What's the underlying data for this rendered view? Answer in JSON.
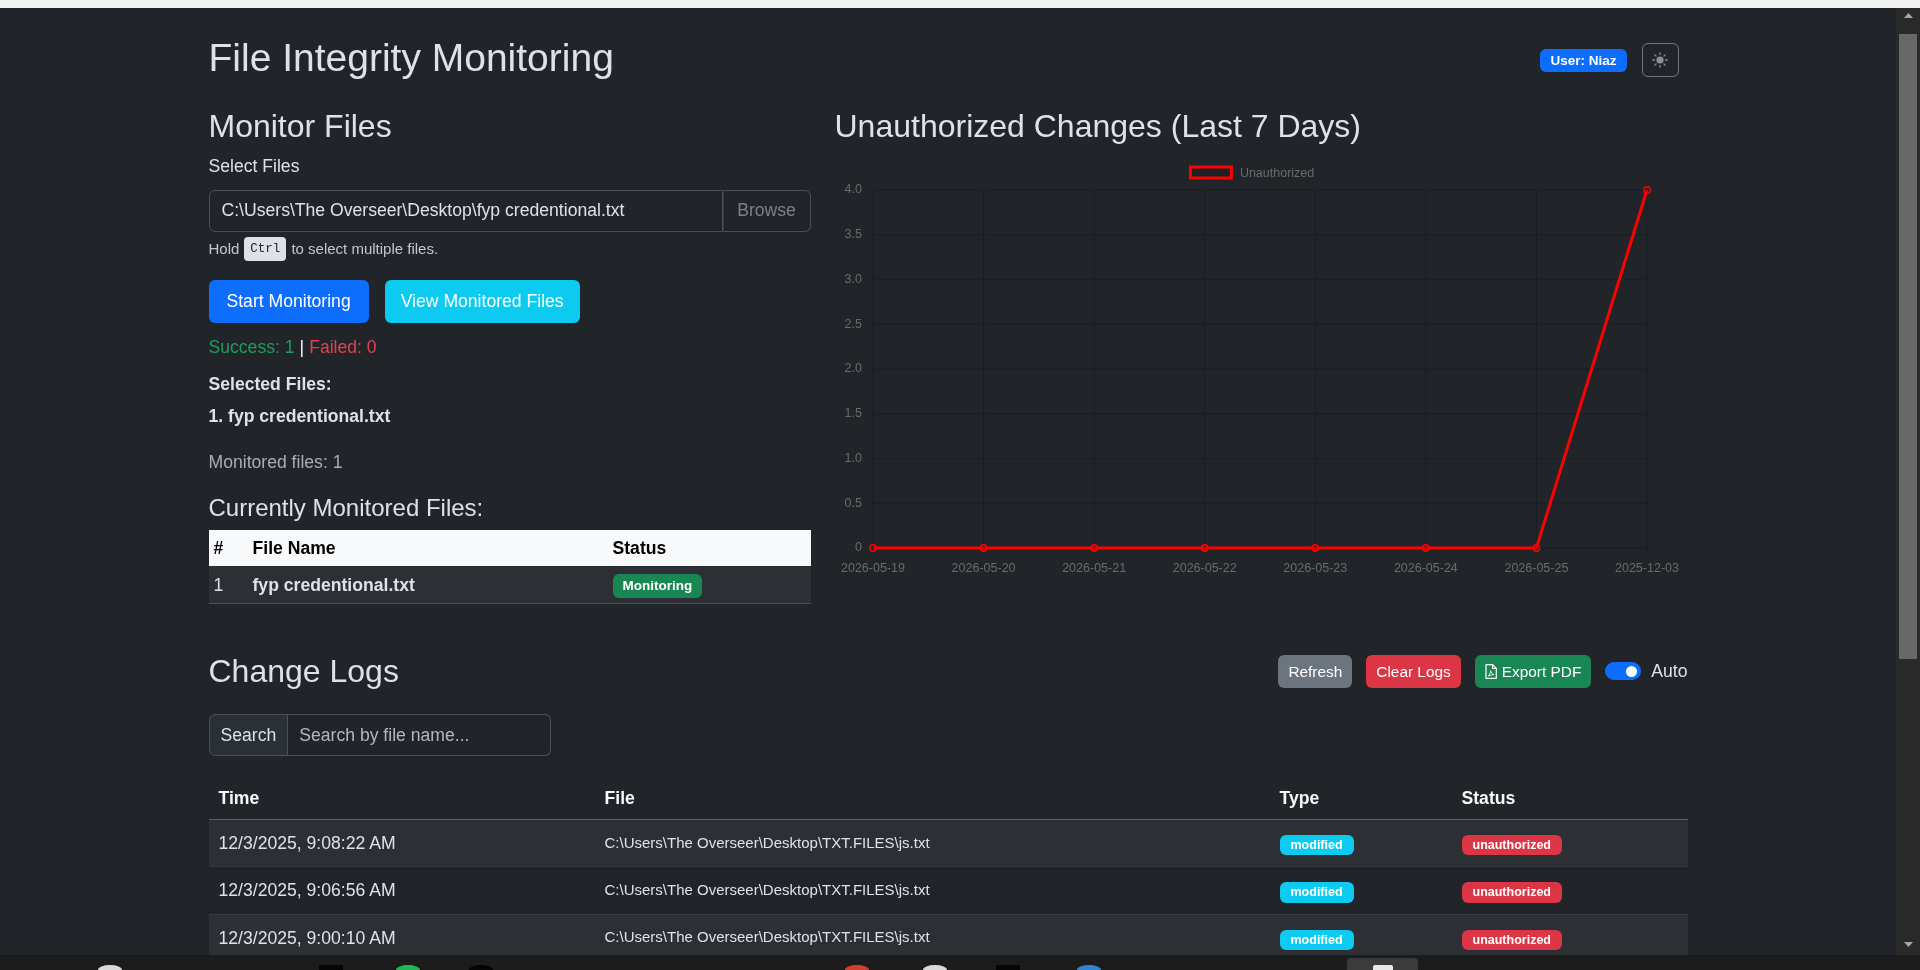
{
  "header": {
    "title": "File Integrity Monitoring",
    "user_badge": "User: Niaz"
  },
  "monitor": {
    "heading": "Monitor Files",
    "field_label": "Select Files",
    "file_field": {
      "value": "C:\\Users\\The Overseer\\Desktop\\fyp credentional.txt",
      "button": "Browse"
    },
    "hint": {
      "before": "Hold",
      "key": "Ctrl",
      "after": "to select multiple files."
    },
    "buttons": [
      {
        "label": "Start Monitoring",
        "kind": "start"
      },
      {
        "label": "View Monitored Files",
        "kind": "view"
      }
    ],
    "result": {
      "success": "Success: 1",
      "separator": "|",
      "failed": "Failed: 0"
    },
    "selected_heading": "Selected Files:",
    "selected_files": [
      "1. fyp credentional.txt"
    ],
    "monitored_count": "Monitored files: 1"
  },
  "monitored_table": {
    "heading": "Currently Monitored Files:",
    "columns": [
      "#",
      "File Name",
      "Status"
    ],
    "rows": [
      {
        "number": "1",
        "file": "fyp credentional.txt",
        "status": "Monitoring"
      }
    ]
  },
  "chart": {
    "chart_data": {
      "type": "line",
      "title": "Unauthorized Changes (Last 7 Days)",
      "categories": [
        "2026-05-19",
        "2026-05-20",
        "2026-05-21",
        "2026-05-22",
        "2026-05-23",
        "2026-05-24",
        "2026-05-25",
        "2025-12-03"
      ],
      "series": [
        {
          "name": "Unauthorized",
          "color": "#ff0000",
          "marker": "circle",
          "values": [
            0,
            0,
            0,
            0,
            0,
            0,
            0,
            4
          ]
        }
      ],
      "ylim": [
        0,
        4
      ],
      "yticks": [
        0,
        0.5,
        {
          "value": 1,
          "label": "1.0"
        },
        1.5,
        {
          "value": 2,
          "label": "2.0"
        },
        2.5,
        {
          "value": 3,
          "label": "3.0"
        },
        3.5,
        {
          "value": 4,
          "label": "4.0"
        }
      ],
      "grid": true
    }
  },
  "logs": {
    "heading": "Change Logs",
    "buttons": [
      {
        "label": "Refresh",
        "kind": "refresh"
      },
      {
        "label": "Clear Logs",
        "kind": "clear"
      },
      {
        "label": "Export PDF",
        "kind": "export"
      }
    ],
    "auto_refresh": {
      "label": "Auto",
      "on": true
    },
    "search": {
      "label": "Search",
      "placeholder": "Search by file name..."
    },
    "table": {
      "columns": [
        "Time",
        "File",
        "Type",
        "Status"
      ],
      "rows": [
        {
          "time": "12/3/2025, 9:08:22 AM",
          "file": "C:\\Users\\The Overseer\\Desktop\\TXT.FILES\\js.txt",
          "type": "modified",
          "status": "unauthorized"
        },
        {
          "time": "12/3/2025, 9:06:56 AM",
          "file": "C:\\Users\\The Overseer\\Desktop\\TXT.FILES\\js.txt",
          "type": "modified",
          "status": "unauthorized"
        },
        {
          "time": "12/3/2025, 9:00:10 AM",
          "file": "C:\\Users\\The Overseer\\Desktop\\TXT.FILES\\js.txt",
          "type": "modified",
          "status": "unauthorized"
        }
      ]
    }
  }
}
